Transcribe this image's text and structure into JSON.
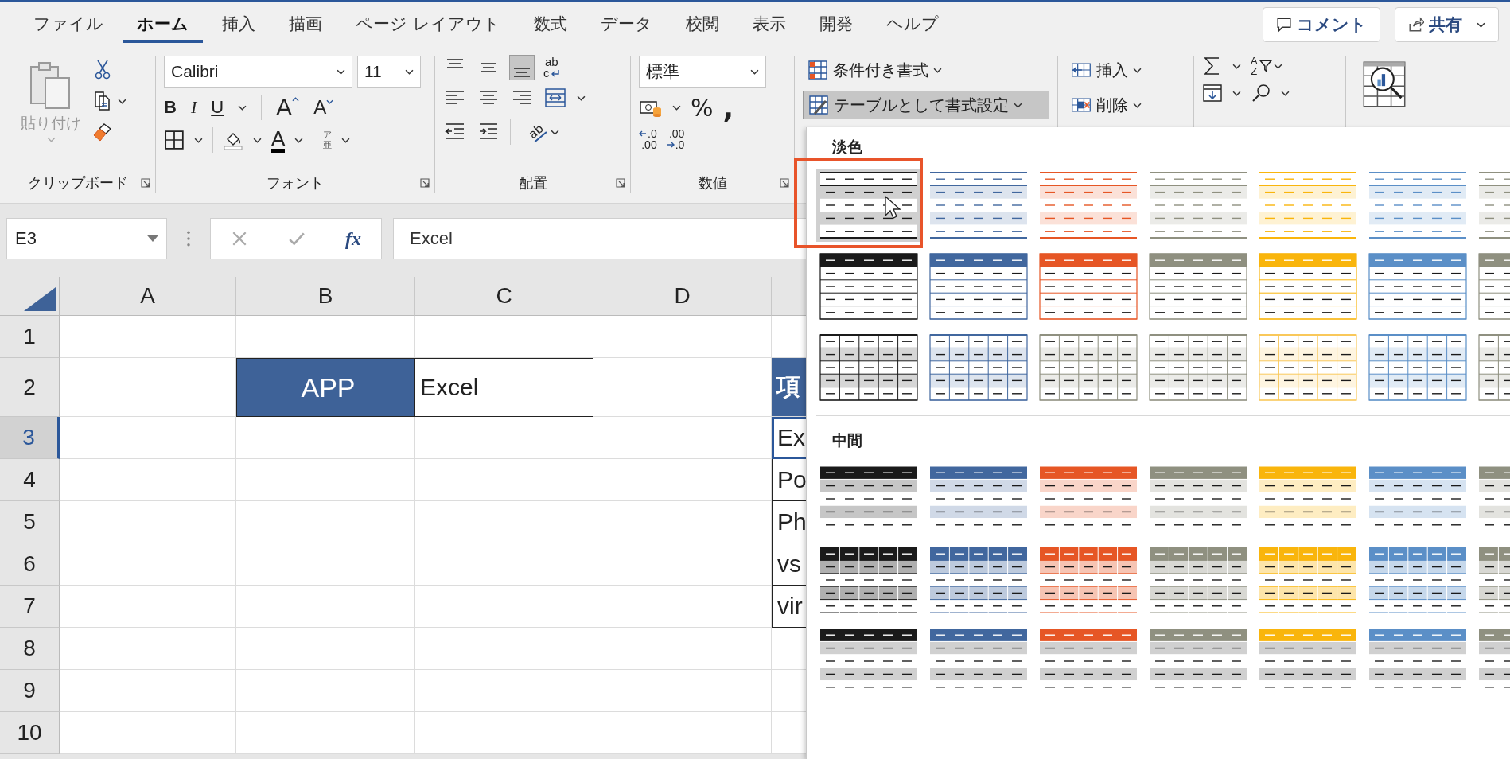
{
  "tabs": [
    {
      "label": "ファイル",
      "selected": false
    },
    {
      "label": "ホーム",
      "selected": true
    },
    {
      "label": "挿入",
      "selected": false
    },
    {
      "label": "描画",
      "selected": false
    },
    {
      "label": "ページ レイアウト",
      "selected": false
    },
    {
      "label": "数式",
      "selected": false
    },
    {
      "label": "データ",
      "selected": false
    },
    {
      "label": "校閲",
      "selected": false
    },
    {
      "label": "表示",
      "selected": false
    },
    {
      "label": "開発",
      "selected": false
    },
    {
      "label": "ヘルプ",
      "selected": false
    }
  ],
  "top_buttons": {
    "comment": "コメント",
    "share": "共有"
  },
  "clipboard": {
    "label": "クリップボード",
    "paste": "貼り付け",
    "paste_disabled": true
  },
  "font": {
    "label": "フォント",
    "name": "Calibri",
    "size": "11",
    "bold": "B",
    "italic": "I",
    "underline": "U",
    "grow": "A",
    "shrink": "A",
    "color_letter": "A",
    "phonetic_top": "ア",
    "phonetic_bottom": "亜"
  },
  "alignment": {
    "label": "配置",
    "wrap_top": "ab",
    "wrap_bottom": "c",
    "orientation": "ab",
    "bottom_align_selected": true
  },
  "number": {
    "label": "数値",
    "format": "標準",
    "percent": "%",
    "comma": ",",
    "increase_decimal": [
      ".0",
      ".00"
    ],
    "decrease_decimal": [
      ".00",
      ".0"
    ]
  },
  "styles": {
    "conditional": "条件付き書式",
    "format_as_table": "テーブルとして書式設定",
    "format_as_table_pressed": true
  },
  "cells": {
    "insert": "挿入",
    "delete": "削除"
  },
  "editing": {
    "sort_top": "A",
    "sort_bottom": "Z"
  },
  "formula_bar": {
    "name_box": "E3",
    "fx": "fx",
    "value": "Excel"
  },
  "sheet": {
    "columns": [
      "A",
      "B",
      "C",
      "D",
      ""
    ],
    "rows": [
      {
        "number": "1",
        "selected": false,
        "cells": [
          "",
          "",
          "",
          "",
          ""
        ]
      },
      {
        "number": "2",
        "selected": false,
        "cells": [
          "",
          "APP",
          "Excel",
          "",
          "項"
        ]
      },
      {
        "number": "3",
        "selected": true,
        "cells": [
          "",
          "",
          "",
          "",
          "Ex"
        ]
      },
      {
        "number": "4",
        "selected": false,
        "cells": [
          "",
          "",
          "",
          "",
          "Po"
        ]
      },
      {
        "number": "5",
        "selected": false,
        "cells": [
          "",
          "",
          "",
          "",
          "Ph"
        ]
      },
      {
        "number": "6",
        "selected": false,
        "cells": [
          "",
          "",
          "",
          "",
          "vs"
        ]
      },
      {
        "number": "7",
        "selected": false,
        "cells": [
          "",
          "",
          "",
          "",
          "vir"
        ]
      },
      {
        "number": "8",
        "selected": false,
        "cells": [
          "",
          "",
          "",
          "",
          ""
        ]
      },
      {
        "number": "9",
        "selected": false,
        "cells": [
          "",
          "",
          "",
          "",
          ""
        ]
      },
      {
        "number": "10",
        "selected": false,
        "cells": [
          "",
          "",
          "",
          "",
          ""
        ]
      }
    ]
  },
  "gallery": {
    "sections": [
      {
        "title": "淡色",
        "rows": [
          {
            "kind": "light-banded",
            "items": [
              {
                "color": "#1a1a1a",
                "selected": true
              },
              {
                "color": "#41679e",
                "selected": false
              },
              {
                "color": "#e65625",
                "selected": false
              },
              {
                "color": "#8f9080",
                "selected": false
              },
              {
                "color": "#f9b50c",
                "selected": false
              },
              {
                "color": "#5b8fc7",
                "selected": false
              },
              {
                "color": "#8f9080",
                "selected": false
              }
            ]
          },
          {
            "kind": "light-header",
            "items": [
              {
                "color": "#1a1a1a",
                "selected": false
              },
              {
                "color": "#41679e",
                "selected": false
              },
              {
                "color": "#e65625",
                "selected": false
              },
              {
                "color": "#8f9080",
                "selected": false
              },
              {
                "color": "#f9b50c",
                "selected": false
              },
              {
                "color": "#5b8fc7",
                "selected": false
              },
              {
                "color": "#8f9080",
                "selected": false
              }
            ]
          },
          {
            "kind": "light-grid",
            "items": [
              {
                "color": "#1a1a1a",
                "selected": false
              },
              {
                "color": "#41679e",
                "selected": false
              },
              {
                "color": "#8f9080",
                "selected": false
              },
              {
                "color": "#8f9080",
                "selected": false
              },
              {
                "color": "#f9c85a",
                "selected": false
              },
              {
                "color": "#5b8fc7",
                "selected": false
              },
              {
                "color": "#8f9080",
                "selected": false
              }
            ]
          }
        ]
      },
      {
        "title": "中間",
        "rows": [
          {
            "kind": "medium-banded",
            "items": [
              {
                "color": "#1a1a1a",
                "selected": false
              },
              {
                "color": "#41679e",
                "selected": false
              },
              {
                "color": "#e65625",
                "selected": false
              },
              {
                "color": "#8f9080",
                "selected": false
              },
              {
                "color": "#f9b50c",
                "selected": false
              },
              {
                "color": "#5b8fc7",
                "selected": false
              },
              {
                "color": "#8f9080",
                "selected": false
              }
            ]
          },
          {
            "kind": "medium-grid",
            "items": [
              {
                "color": "#1a1a1a",
                "selected": false
              },
              {
                "color": "#41679e",
                "selected": false
              },
              {
                "color": "#e65625",
                "selected": false
              },
              {
                "color": "#8f9080",
                "selected": false
              },
              {
                "color": "#f9b50c",
                "selected": false
              },
              {
                "color": "#5b8fc7",
                "selected": false
              },
              {
                "color": "#8f9080",
                "selected": false
              }
            ]
          },
          {
            "kind": "medium-header",
            "items": [
              {
                "color": "#1a1a1a",
                "selected": false
              },
              {
                "color": "#41679e",
                "selected": false
              },
              {
                "color": "#e65625",
                "selected": false
              },
              {
                "color": "#8f9080",
                "selected": false
              },
              {
                "color": "#f9b50c",
                "selected": false
              },
              {
                "color": "#5b8fc7",
                "selected": false
              },
              {
                "color": "#8f9080",
                "selected": false
              }
            ]
          }
        ]
      }
    ]
  }
}
